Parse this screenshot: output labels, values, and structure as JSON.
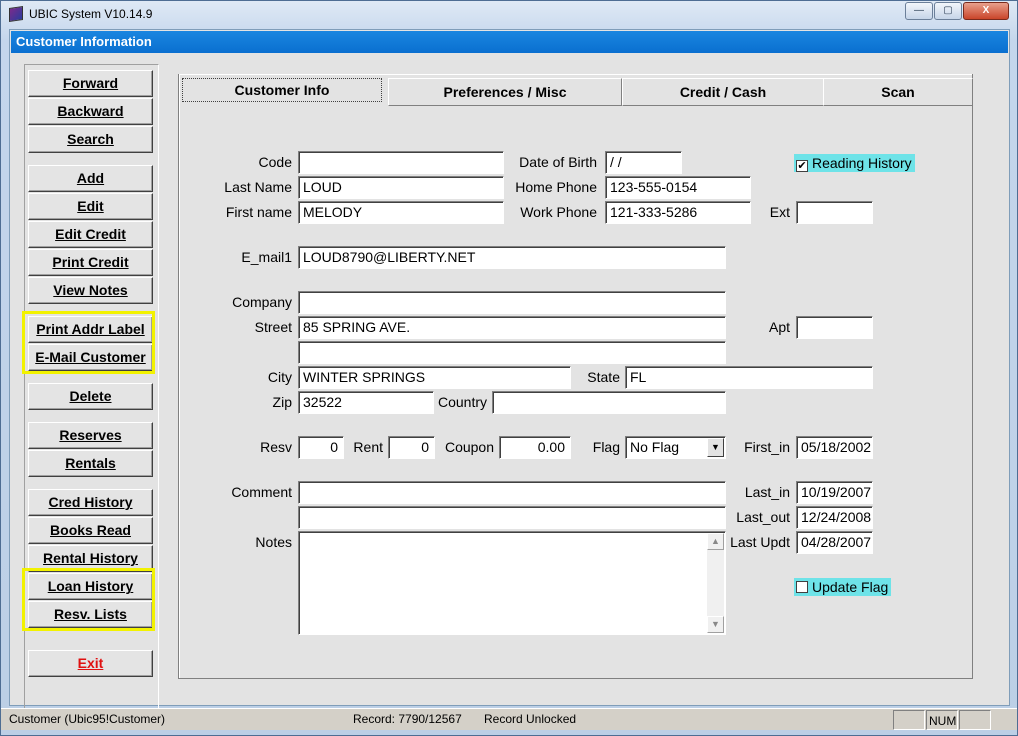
{
  "window": {
    "title": "UBIC System V10.14.9",
    "controls": {
      "minimize": "—",
      "maximize": "▢",
      "close": "X"
    }
  },
  "header": {
    "title": "Customer Information"
  },
  "sidebar": {
    "buttons": [
      {
        "id": "forward",
        "label": "Forward"
      },
      {
        "id": "backward",
        "label": "Backward"
      },
      {
        "id": "search",
        "label": "Search"
      },
      {
        "id": "add",
        "label": "Add"
      },
      {
        "id": "edit",
        "label": "Edit"
      },
      {
        "id": "edit-credit",
        "label": "Edit Credit"
      },
      {
        "id": "print-credit",
        "label": "Print Credit"
      },
      {
        "id": "view-notes",
        "label": "View Notes"
      },
      {
        "id": "print-addr-label",
        "label": "Print Addr Label"
      },
      {
        "id": "email-customer",
        "label": "E-Mail Customer"
      },
      {
        "id": "delete",
        "label": "Delete"
      },
      {
        "id": "reserves",
        "label": "Reserves"
      },
      {
        "id": "rentals",
        "label": "Rentals"
      },
      {
        "id": "cred-history",
        "label": "Cred History"
      },
      {
        "id": "books-read",
        "label": "Books Read"
      },
      {
        "id": "rental-history",
        "label": "Rental History"
      },
      {
        "id": "loan-history",
        "label": "Loan History"
      },
      {
        "id": "resv-lists",
        "label": "Resv. Lists"
      },
      {
        "id": "exit",
        "label": "Exit"
      }
    ]
  },
  "tabs": [
    {
      "label": "Customer Info",
      "active": true
    },
    {
      "label": "Preferences / Misc",
      "active": false
    },
    {
      "label": "Credit / Cash",
      "active": false
    },
    {
      "label": "Scan",
      "active": false
    }
  ],
  "form": {
    "labels": {
      "code": "Code",
      "last_name": "Last Name",
      "first_name": "First name",
      "dob": "Date of Birth",
      "home_phone": "Home Phone",
      "work_phone": "Work Phone",
      "ext": "Ext",
      "email1": "E_mail1",
      "company": "Company",
      "street": "Street",
      "apt": "Apt",
      "city": "City",
      "state": "State",
      "zip": "Zip",
      "country": "Country",
      "resv": "Resv",
      "rent": "Rent",
      "coupon": "Coupon",
      "flag": "Flag",
      "first_in": "First_in",
      "comment": "Comment",
      "last_in": "Last_in",
      "last_out": "Last_out",
      "last_updt": "Last Updt",
      "notes": "Notes"
    },
    "values": {
      "code": "",
      "last_name": "LOUD",
      "first_name": "MELODY",
      "dob": " /  /",
      "home_phone": "123-555-0154",
      "work_phone": "121-333-5286",
      "ext": "",
      "email1": "LOUD8790@LIBERTY.NET",
      "company": "",
      "street": "85 SPRING AVE.",
      "street2": "",
      "apt": "",
      "city": "WINTER SPRINGS",
      "state": "FL",
      "zip": "32522",
      "country": "",
      "resv": "0",
      "rent": "0",
      "coupon": "0.00",
      "flag": "No Flag",
      "first_in": "05/18/2002",
      "comment": "",
      "comment2": "",
      "last_in": "10/19/2007",
      "last_out": "12/24/2008",
      "last_updt": "04/28/2007",
      "notes": ""
    },
    "checkboxes": {
      "reading_history": {
        "label": "Reading History",
        "checked": true,
        "mark": "✔"
      },
      "update_flag": {
        "label": "Update Flag",
        "checked": false,
        "mark": ""
      }
    }
  },
  "status": {
    "table": "Customer (Ubic95!Customer)",
    "record": "Record: 7790/12567",
    "lock": "Record Unlocked",
    "num": "NUM"
  },
  "colors": {
    "header_bg": "#0a6fd0",
    "highlight": "#f2f200",
    "checkbox_bg": "#6ee3e8",
    "exit_text": "#e01010"
  }
}
